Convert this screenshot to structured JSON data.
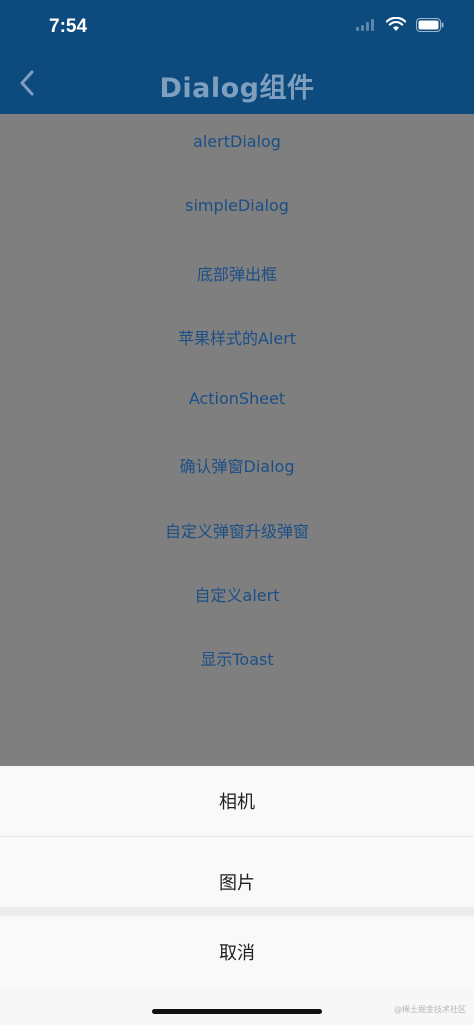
{
  "status_bar": {
    "time": "7:54",
    "icons": [
      "cellular-signal-icon",
      "wifi-icon",
      "battery-icon"
    ]
  },
  "app_bar": {
    "title": "Dialog组件",
    "back_icon": "chevron-left-icon",
    "background": "#0d4a7e"
  },
  "menu": {
    "items": [
      {
        "label": "alertDialog"
      },
      {
        "label": "simpleDialog"
      },
      {
        "label": "底部弹出框"
      },
      {
        "label": "苹果样式的Alert"
      },
      {
        "label": "ActionSheet"
      },
      {
        "label": "确认弹窗Dialog"
      },
      {
        "label": "自定义弹窗升级弹窗"
      },
      {
        "label": "自定义alert"
      },
      {
        "label": "显示Toast"
      }
    ],
    "text_color": "#1b4f86"
  },
  "bottom_sheet": {
    "options": [
      {
        "label": "相机"
      },
      {
        "label": "图片"
      }
    ],
    "cancel_label": "取消"
  },
  "watermark": "@稀土掘金技术社区"
}
